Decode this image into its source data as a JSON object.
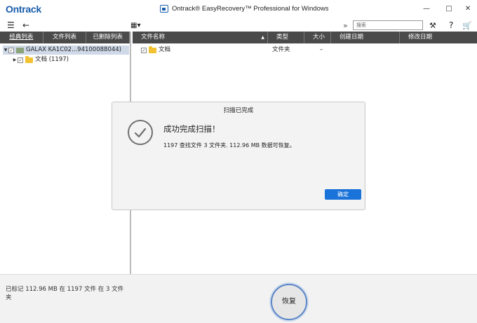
{
  "titlebar": {
    "brand": "Ontrack",
    "title": "Ontrack® EasyRecovery™ Professional for Windows",
    "minimize_icon": "minimize-icon",
    "maximize_icon": "maximize-icon",
    "close_icon": "close-icon"
  },
  "toolbar": {
    "search_placeholder": "搜索",
    "menu_icon": "hamburger-icon",
    "back_icon": "back-arrow-icon",
    "view_icon": "grid-view-icon",
    "expand_icon": "double-chevron-icon",
    "tools_icon": "wrench-icon",
    "help_icon": "question-icon",
    "cart_icon": "cart-icon",
    "help_label": "?"
  },
  "left_panel": {
    "tabs": [
      {
        "label": "经典列表"
      },
      {
        "label": "文件列表"
      },
      {
        "label": "已删除列表"
      }
    ],
    "tree": [
      {
        "label": "GALAX KA1C02...94100088044)"
      },
      {
        "label": "文档 (1197)"
      }
    ]
  },
  "right_panel": {
    "columns": [
      {
        "label": "文件名称"
      },
      {
        "label": "类型"
      },
      {
        "label": "大小"
      },
      {
        "label": "创建日期"
      },
      {
        "label": "修改日期"
      }
    ],
    "rows": [
      {
        "name": "文档",
        "type": "文件夹",
        "size": "–"
      }
    ]
  },
  "dialog": {
    "title": "扫描已完成",
    "heading": "成功完成扫描！",
    "message": "1197 查找文件 3 文件夹. 112.96 MB 数据可恢复。",
    "ok_label": "确定"
  },
  "status": {
    "text": "已标记 112.96 MB 在 1197 文件 在 3 文件夹"
  },
  "recover_label": "恢复",
  "colors": {
    "brand": "#1a5dab",
    "header_bg": "#4a4a4a",
    "ok_button": "#1a73d9",
    "recover_ring": "#5b86c5"
  }
}
